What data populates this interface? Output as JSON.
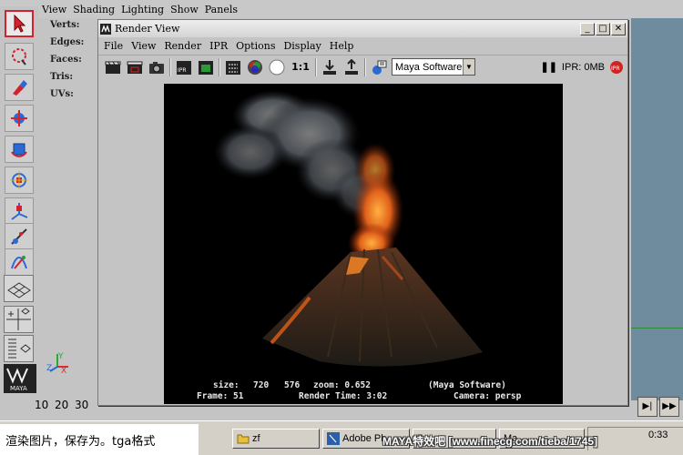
{
  "maya_menubar": {
    "items": [
      "View",
      "Shading",
      "Lighting",
      "Show",
      "Panels"
    ]
  },
  "hud": {
    "verts": "Verts:",
    "edges": "Edges:",
    "faces": "Faces:",
    "tris": "Tris:",
    "uvs": "UVs:"
  },
  "render_view": {
    "title": "Render View",
    "menu": [
      "File",
      "View",
      "Render",
      "IPR",
      "Options",
      "Display",
      "Help"
    ],
    "toolbar": {
      "ratio_label": "1:1",
      "renderer": "Maya Software",
      "ipr_memory": "IPR: 0MB",
      "ipr_badge": "IPR",
      "ipr_icon_label": "IPR"
    },
    "caption": {
      "size_label": "size:",
      "size_value": "720",
      "size_value2": "576",
      "zoom": "zoom: 0.652",
      "renderer": "(Maya Software)",
      "frame": "Frame: 51",
      "render_time": "Render Time: 3:02",
      "camera": "Camera: persp"
    }
  },
  "time_slider": {
    "ticks": [
      "10",
      "20",
      "30"
    ]
  },
  "axis_labels": {
    "x": "X",
    "y": "Y",
    "z": "Z"
  },
  "taskbar": {
    "note": "渲染图片，保存为。tga格式",
    "items": [
      "zf",
      "Adobe Ph",
      "7.",
      "Ma"
    ],
    "clock": "0:33"
  },
  "watermark": "MAYA特效吧 [www.finecg.com/tieba/1745]",
  "logo_text": "MAYA"
}
